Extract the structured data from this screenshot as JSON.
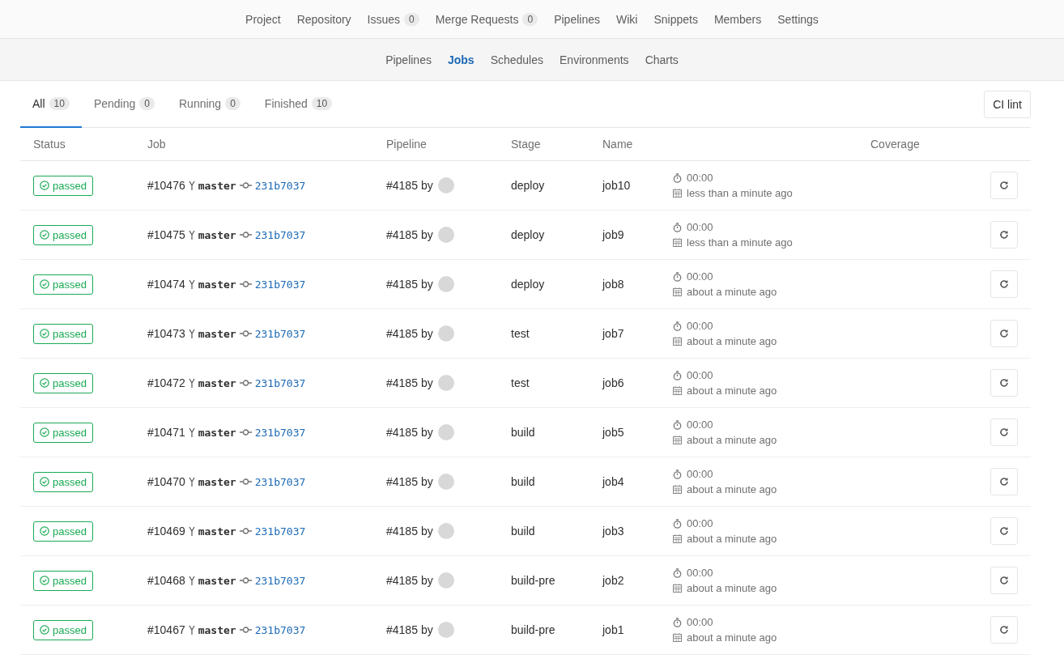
{
  "nav": [
    {
      "label": "Project"
    },
    {
      "label": "Repository"
    },
    {
      "label": "Issues",
      "count": "0"
    },
    {
      "label": "Merge Requests",
      "count": "0"
    },
    {
      "label": "Pipelines"
    },
    {
      "label": "Wiki"
    },
    {
      "label": "Snippets"
    },
    {
      "label": "Members"
    },
    {
      "label": "Settings"
    }
  ],
  "subnav": [
    {
      "label": "Pipelines",
      "selected": false
    },
    {
      "label": "Jobs",
      "selected": true
    },
    {
      "label": "Schedules",
      "selected": false
    },
    {
      "label": "Environments",
      "selected": false
    },
    {
      "label": "Charts",
      "selected": false
    }
  ],
  "tabs": [
    {
      "label": "All",
      "count": "10",
      "selected": true
    },
    {
      "label": "Pending",
      "count": "0",
      "selected": false
    },
    {
      "label": "Running",
      "count": "0",
      "selected": false
    },
    {
      "label": "Finished",
      "count": "10",
      "selected": false
    }
  ],
  "ci_lint_button": "CI lint",
  "table": {
    "columns": [
      "Status",
      "Job",
      "Pipeline",
      "Stage",
      "Name",
      "Coverage"
    ],
    "rows": [
      {
        "status": "passed",
        "job": "#10476",
        "ref": "master",
        "commit": "231b7037",
        "pipeline": "#4185",
        "by": "by",
        "stage": "deploy",
        "name": "job10",
        "duration": "00:00",
        "finished": "less than a minute ago"
      },
      {
        "status": "passed",
        "job": "#10475",
        "ref": "master",
        "commit": "231b7037",
        "pipeline": "#4185",
        "by": "by",
        "stage": "deploy",
        "name": "job9",
        "duration": "00:00",
        "finished": "less than a minute ago"
      },
      {
        "status": "passed",
        "job": "#10474",
        "ref": "master",
        "commit": "231b7037",
        "pipeline": "#4185",
        "by": "by",
        "stage": "deploy",
        "name": "job8",
        "duration": "00:00",
        "finished": "about a minute ago"
      },
      {
        "status": "passed",
        "job": "#10473",
        "ref": "master",
        "commit": "231b7037",
        "pipeline": "#4185",
        "by": "by",
        "stage": "test",
        "name": "job7",
        "duration": "00:00",
        "finished": "about a minute ago"
      },
      {
        "status": "passed",
        "job": "#10472",
        "ref": "master",
        "commit": "231b7037",
        "pipeline": "#4185",
        "by": "by",
        "stage": "test",
        "name": "job6",
        "duration": "00:00",
        "finished": "about a minute ago"
      },
      {
        "status": "passed",
        "job": "#10471",
        "ref": "master",
        "commit": "231b7037",
        "pipeline": "#4185",
        "by": "by",
        "stage": "build",
        "name": "job5",
        "duration": "00:00",
        "finished": "about a minute ago"
      },
      {
        "status": "passed",
        "job": "#10470",
        "ref": "master",
        "commit": "231b7037",
        "pipeline": "#4185",
        "by": "by",
        "stage": "build",
        "name": "job4",
        "duration": "00:00",
        "finished": "about a minute ago"
      },
      {
        "status": "passed",
        "job": "#10469",
        "ref": "master",
        "commit": "231b7037",
        "pipeline": "#4185",
        "by": "by",
        "stage": "build",
        "name": "job3",
        "duration": "00:00",
        "finished": "about a minute ago"
      },
      {
        "status": "passed",
        "job": "#10468",
        "ref": "master",
        "commit": "231b7037",
        "pipeline": "#4185",
        "by": "by",
        "stage": "build-pre",
        "name": "job2",
        "duration": "00:00",
        "finished": "about a minute ago"
      },
      {
        "status": "passed",
        "job": "#10467",
        "ref": "master",
        "commit": "231b7037",
        "pipeline": "#4185",
        "by": "by",
        "stage": "build-pre",
        "name": "job1",
        "duration": "00:00",
        "finished": "about a minute ago"
      }
    ]
  }
}
